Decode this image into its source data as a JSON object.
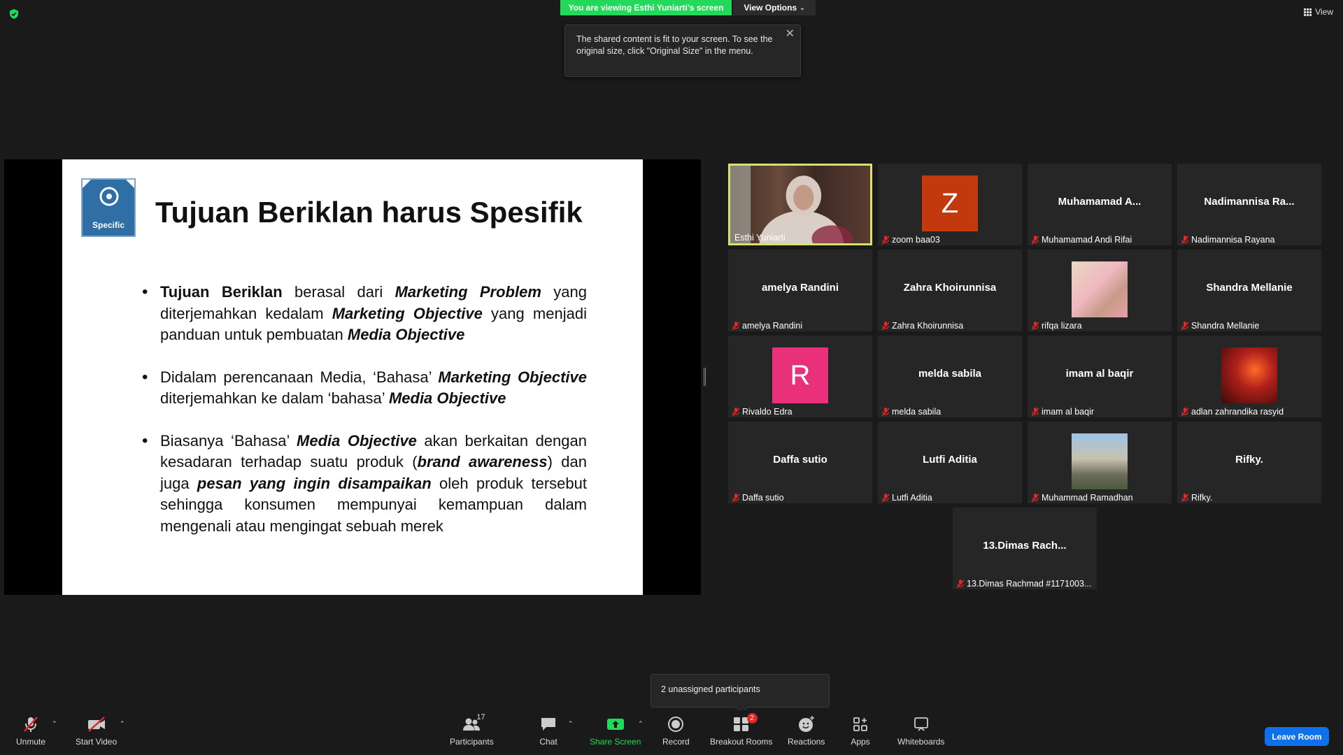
{
  "header": {
    "viewing_banner": "You are viewing Esthi Yuniarti's screen",
    "view_options_label": "View Options",
    "view_label": "View",
    "tooltip_text": "The shared content is fit to your screen. To see the original size, click \"Original Size\" in the menu."
  },
  "slide": {
    "badge_label": "Specific",
    "title": "Tujuan Beriklan harus Spesifik",
    "bullet1": {
      "a": "Tujuan Beriklan",
      "b": " berasal dari ",
      "c": "Marketing Problem",
      "d": " yang diterjemahkan kedalam ",
      "e": "Marketing Objective",
      "f": " yang menjadi panduan untuk pembuatan ",
      "g": "Media Objective"
    },
    "bullet2": {
      "a": "Didalam perencanaan Media, ‘Bahasa’ ",
      "b": "Marketing Objective",
      "c": " diterjemahkan ke dalam  ‘bahasa’ ",
      "d": "Media Objective"
    },
    "bullet3": {
      "a": "Biasanya ‘Bahasa’ ",
      "b": "Media Objective",
      "c": " akan berkaitan dengan kesadaran terhadap suatu produk (",
      "d": "brand awareness",
      "e": ") dan juga ",
      "f": "pesan yang ingin disampaikan",
      "g": " oleh produk tersebut sehingga konsumen mempunyai kemampuan dalam mengenali  atau mengingat sebuah  merek"
    }
  },
  "participants": [
    {
      "big": "",
      "name": "Esthi Yuniarti"
    },
    {
      "big": "",
      "initial": "Z",
      "name": "zoom baa03",
      "color": "#c3390e"
    },
    {
      "big": "Muhamamad  A...",
      "name": "Muhamamad Andi Rifai"
    },
    {
      "big": "Nadimannisa  Ra...",
      "name": "Nadimannisa Rayana"
    },
    {
      "big": "amelya Randini",
      "name": "amelya Randini"
    },
    {
      "big": "Zahra Khoirunnisa",
      "name": "Zahra Khoirunnisa"
    },
    {
      "big": "",
      "name": "rifqa lizara"
    },
    {
      "big": "Shandra Mellanie",
      "name": "Shandra Mellanie"
    },
    {
      "big": "",
      "initial": "R",
      "name": "Rivaldo Edra",
      "color": "#e8317a"
    },
    {
      "big": "melda sabila",
      "name": "melda sabila"
    },
    {
      "big": "imam al baqir",
      "name": "imam al baqir"
    },
    {
      "big": "",
      "name": "adlan zahrandika rasyid"
    },
    {
      "big": "Daffa sutio",
      "name": "Daffa sutio"
    },
    {
      "big": "Lutfi Aditia",
      "name": "Lutfi Aditia"
    },
    {
      "big": "",
      "name": "Muhammad Ramadhan"
    },
    {
      "big": "Rifky.",
      "name": "Rifky."
    },
    {
      "big": "13.Dimas  Rach...",
      "name": "13.Dimas Rachmad #1171003..."
    }
  ],
  "popup": {
    "text": "2 unassigned participants"
  },
  "toolbar": {
    "unmute": "Unmute",
    "start_video": "Start Video",
    "participants": "Participants",
    "participants_count": "17",
    "chat": "Chat",
    "share_screen": "Share Screen",
    "record": "Record",
    "breakout": "Breakout Rooms",
    "breakout_badge": "2",
    "reactions": "Reactions",
    "apps": "Apps",
    "whiteboards": "Whiteboards",
    "leave": "Leave Room"
  }
}
